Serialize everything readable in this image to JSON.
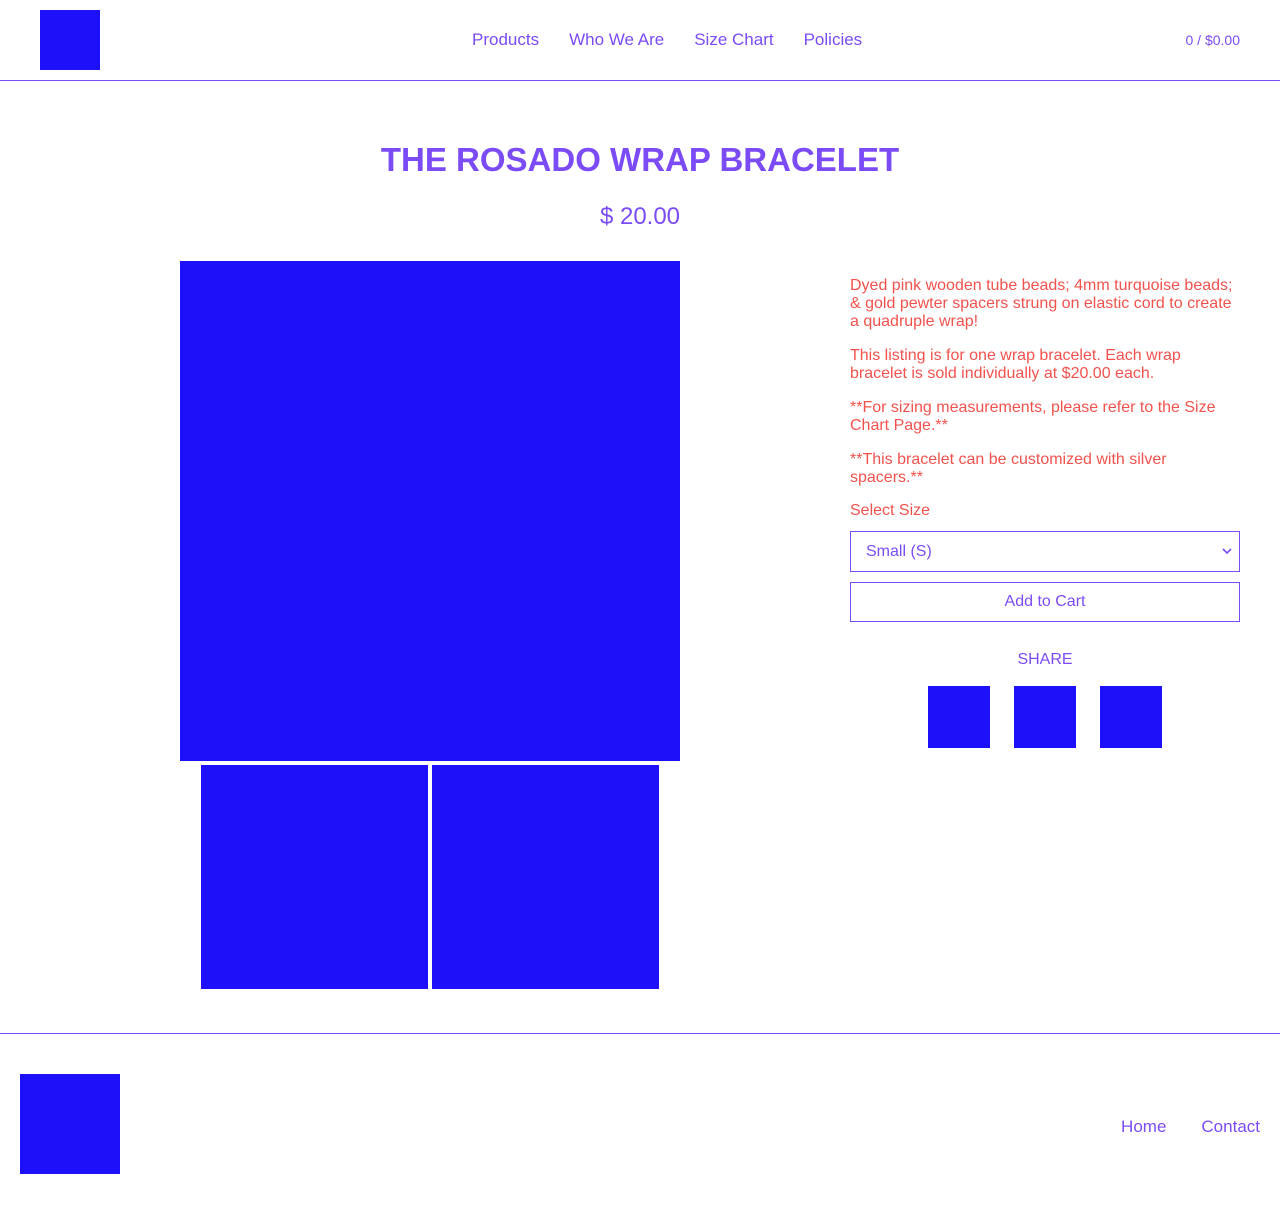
{
  "header": {
    "logo_icon": "logo-image",
    "nav": [
      "Products",
      "Who We Are",
      "Size Chart",
      "Policies"
    ],
    "cart": "0 / $0.00"
  },
  "product": {
    "title": "THE ROSADO WRAP BRACELET",
    "price": "$ 20.00",
    "description": [
      "Dyed pink wooden tube beads; 4mm turquoise beads; & gold pewter spacers strung on elastic cord to create a quadruple wrap!",
      "This listing is for one wrap bracelet. Each wrap bracelet is sold individually at $20.00 each.",
      "**For sizing measurements, please refer to the Size Chart Page.**",
      "**This bracelet can be customized with silver spacers.**"
    ],
    "select_label": "Select Size",
    "size_selected": "Small (S)",
    "add_to_cart": "Add to Cart",
    "share_label": "SHARE",
    "share_icons": [
      "facebook-icon",
      "twitter-icon",
      "pinterest-icon"
    ]
  },
  "footer": {
    "logo_icon": "logo-image",
    "nav": [
      "Home",
      "Contact"
    ]
  },
  "colors": {
    "accent": "#7b4cf5",
    "text_description": "#f2524d",
    "placeholder_block": "#1e10f8",
    "background": "#ffffff"
  }
}
